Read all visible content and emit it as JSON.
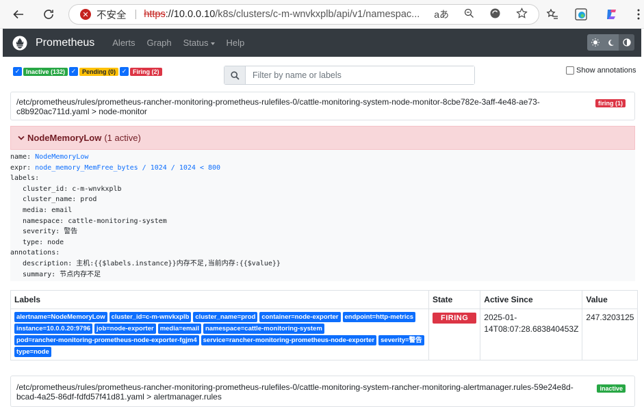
{
  "browser": {
    "insecure_label": "不安全",
    "url_scheme": "https",
    "url_host": "://10.0.0.10",
    "url_path": "/k8s/clusters/c-m-wnvkxplb/api/v1/namespac..."
  },
  "navbar": {
    "brand": "Prometheus",
    "links": [
      "Alerts",
      "Graph",
      "Status",
      "Help"
    ]
  },
  "filters": {
    "inactive": "Inactive (132)",
    "pending": "Pending (0)",
    "firing": "Firing (2)",
    "search_placeholder": "Filter by name or labels",
    "show_annotations": "Show annotations"
  },
  "file1": {
    "path": "/etc/prometheus/rules/prometheus-rancher-monitoring-prometheus-rulefiles-0/cattle-monitoring-system-node-monitor-8cbe782e-3aff-4e48-ae73-c8b920ac711d.yaml > node-monitor",
    "badge": "firing (1)"
  },
  "rule": {
    "name": "NodeMemoryLow",
    "count": "(1 active)",
    "def_name_key": "name: ",
    "def_name_val": "NodeMemoryLow",
    "def_expr_key": "expr: ",
    "def_expr_val": "node_memory_MemFree_bytes / 1024 / 1024 < 800",
    "labels_key": "labels:",
    "labels": [
      "cluster_id: c-m-wnvkxplb",
      "cluster_name: prod",
      "media: email",
      "namespace: cattle-monitoring-system",
      "severity: 警告",
      "type: node"
    ],
    "annotations_key": "annotations:",
    "annotations": [
      "description: 主机:{{$labels.instance}}内存不足,当前内存:{{$value}}",
      "summary: 节点内存不足"
    ]
  },
  "table": {
    "headers": [
      "Labels",
      "State",
      "Active Since",
      "Value"
    ],
    "row": {
      "labels": [
        "alertname=NodeMemoryLow",
        "cluster_id=c-m-wnvkxplb",
        "cluster_name=prod",
        "container=node-exporter",
        "endpoint=http-metrics",
        "instance=10.0.0.20:9796",
        "job=node-exporter",
        "media=email",
        "namespace=cattle-monitoring-system",
        "pod=rancher-monitoring-prometheus-node-exporter-fgjm4",
        "service=rancher-monitoring-prometheus-node-exporter",
        "severity=警告",
        "type=node"
      ],
      "state": "FIRING",
      "active_since_line1": "2025-01-",
      "active_since_line2": "14T08:07:28.683840453Z",
      "value": "247.3203125"
    }
  },
  "file2": {
    "path": "/etc/prometheus/rules/prometheus-rancher-monitoring-prometheus-rulefiles-0/cattle-monitoring-system-rancher-monitoring-alertmanager.rules-59e24e8d-bcad-4a25-86df-fdfd57f41d81.yaml > alertmanager.rules",
    "badge": "inactive"
  },
  "colors": {
    "navbar": "#343a40",
    "firing": "#dc3545",
    "inactive": "#28a745",
    "pending": "#ffc107",
    "label_badge": "#0d6efd",
    "rule_header_bg": "#f8d7da"
  }
}
